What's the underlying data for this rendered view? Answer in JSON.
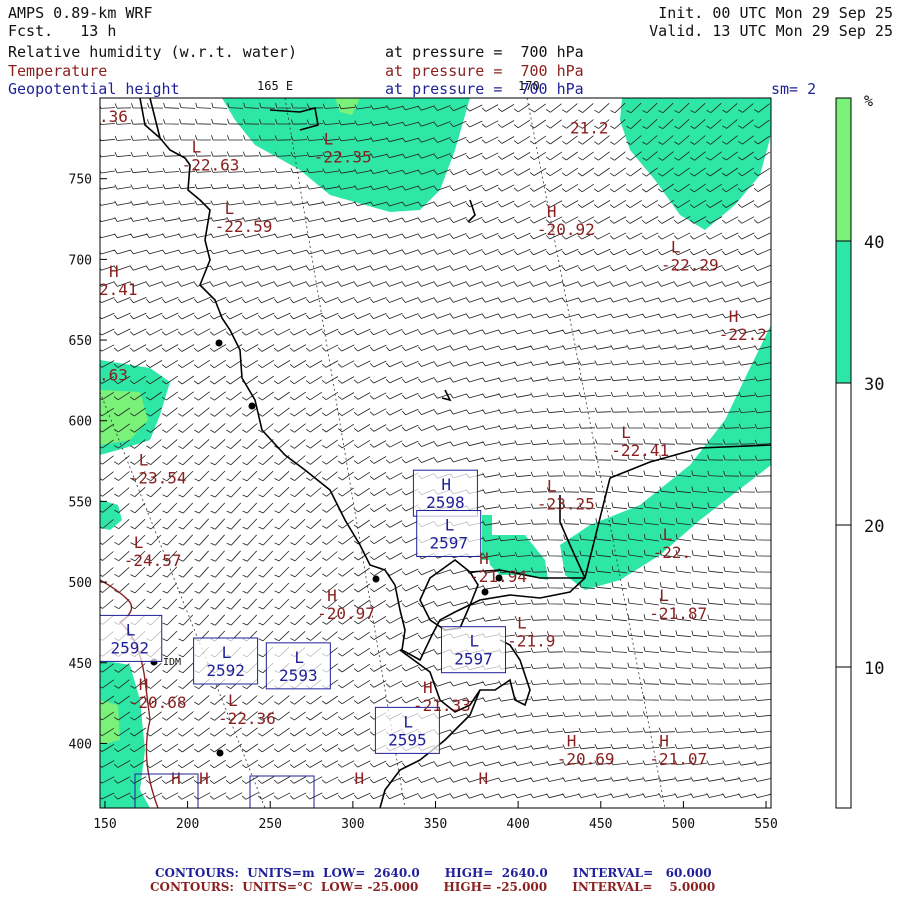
{
  "header": {
    "model": "AMPS 0.89-km WRF",
    "fcst_label": "Fcst.",
    "fcst_value": "13 h",
    "init": "Init. 00 UTC Mon 29 Sep 25",
    "valid": "Valid. 13 UTC Mon 29 Sep 25",
    "fields": [
      {
        "name": "Relative humidity (w.r.t. water)",
        "level": "at pressure =  700 hPa"
      },
      {
        "name": "Temperature",
        "level": "at pressure =  700 hPa"
      },
      {
        "name": "Geopotential height",
        "level": "at pressure =  700 hPa"
      }
    ],
    "smoothing": "sm= 2",
    "lon_165": "165 E",
    "lon_170": "170"
  },
  "colors": {
    "rh_30_40": "#2ee6a6",
    "rh_40_plus": "#7af27a",
    "temperature": "#8a1f1f",
    "height": "#1f1f9a",
    "coast": "#000000"
  },
  "colorbar": {
    "unit": "%",
    "ticks": [
      "40",
      "30",
      "20",
      "10"
    ]
  },
  "axes": {
    "x_ticks": [
      "150",
      "200",
      "250",
      "300",
      "350",
      "400",
      "450",
      "500",
      "550"
    ],
    "y_ticks": [
      "750",
      "700",
      "650",
      "600",
      "550",
      "500",
      "450",
      "400"
    ]
  },
  "temperature_labels": [
    {
      "letter": "",
      "value": ".36",
      "x": 150,
      "y": 785
    },
    {
      "letter": "L",
      "value": "-22.63",
      "x": 200,
      "y": 755
    },
    {
      "letter": "L",
      "value": "-22.35",
      "x": 280,
      "y": 760
    },
    {
      "letter": "",
      "value": "21.2",
      "x": 435,
      "y": 778
    },
    {
      "letter": "L",
      "value": "-22.59",
      "x": 220,
      "y": 717
    },
    {
      "letter": "H",
      "value": "-20.92",
      "x": 415,
      "y": 715
    },
    {
      "letter": "H",
      "value": "2.41",
      "x": 150,
      "y": 678
    },
    {
      "letter": "L",
      "value": "-22.29",
      "x": 490,
      "y": 693
    },
    {
      "letter": "H",
      "value": "-22.2",
      "x": 525,
      "y": 650
    },
    {
      "letter": "",
      "value": ".63",
      "x": 150,
      "y": 625
    },
    {
      "letter": "L",
      "value": "-22.41",
      "x": 460,
      "y": 578
    },
    {
      "letter": "L",
      "value": "-23.54",
      "x": 168,
      "y": 561
    },
    {
      "letter": "L",
      "value": "-23.25",
      "x": 415,
      "y": 545
    },
    {
      "letter": "L",
      "value": "-22.",
      "x": 485,
      "y": 515
    },
    {
      "letter": "L",
      "value": "-24.57",
      "x": 165,
      "y": 510
    },
    {
      "letter": "H",
      "value": "-21.94",
      "x": 374,
      "y": 500
    },
    {
      "letter": "H",
      "value": "-20.97",
      "x": 282,
      "y": 477
    },
    {
      "letter": "L",
      "value": "-21.87",
      "x": 483,
      "y": 477
    },
    {
      "letter": "L",
      "value": "-21.9",
      "x": 397,
      "y": 460
    },
    {
      "letter": "H",
      "value": "-21.33",
      "x": 340,
      "y": 420
    },
    {
      "letter": "H",
      "value": "-20.68",
      "x": 168,
      "y": 422
    },
    {
      "letter": "L",
      "value": "-22.36",
      "x": 222,
      "y": 412
    },
    {
      "letter": "H",
      "value": "-20.69",
      "x": 427,
      "y": 387
    },
    {
      "letter": "H",
      "value": "-21.07",
      "x": 483,
      "y": 387
    }
  ],
  "height_labels": [
    {
      "letter": "H",
      "value": "2598",
      "x": 356,
      "y": 552
    },
    {
      "letter": "L",
      "value": "2597",
      "x": 358,
      "y": 527
    },
    {
      "letter": "L",
      "value": "2592",
      "x": 165,
      "y": 462
    },
    {
      "letter": "L",
      "value": "2592",
      "x": 223,
      "y": 448
    },
    {
      "letter": "L",
      "value": "2593",
      "x": 267,
      "y": 445
    },
    {
      "letter": "L",
      "value": "2597",
      "x": 373,
      "y": 455
    },
    {
      "letter": "L",
      "value": "2595",
      "x": 333,
      "y": 405
    }
  ],
  "edge_letters": [
    {
      "text": "H",
      "x": 190,
      "y": 375,
      "color": "temperature"
    },
    {
      "text": "H",
      "x": 207,
      "y": 375,
      "color": "temperature"
    },
    {
      "text": "H",
      "x": 301,
      "y": 375,
      "color": "temperature"
    },
    {
      "text": "H",
      "x": 376,
      "y": 375,
      "color": "temperature"
    }
  ],
  "place_label": "IDM",
  "footer": {
    "line1": {
      "prefix": "CONTOURS:",
      "units": "UNITS=m",
      "low": "LOW=  2640.0",
      "high": "HIGH=  2640.0",
      "interval": "INTERVAL=   60.000"
    },
    "line2": {
      "prefix": "CONTOURS:",
      "units": "UNITS=°C",
      "low": "LOW= -25.000",
      "high": "HIGH= -25.000",
      "interval": "INTERVAL=    5.0000"
    }
  }
}
